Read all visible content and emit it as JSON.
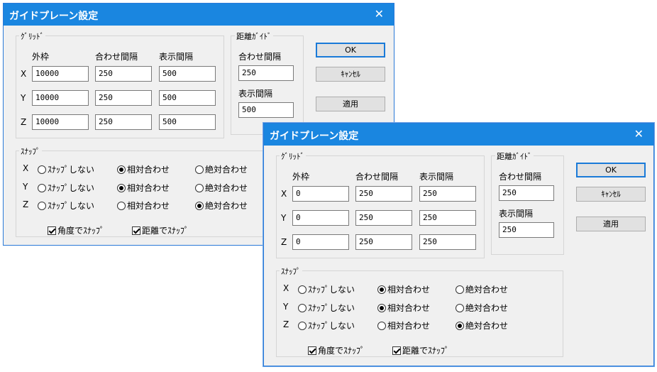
{
  "dialogs": [
    {
      "title": "ガイドプレーン設定",
      "grid_label": "ｸﾞﾘｯﾄﾞ",
      "col_outer": "外枠",
      "col_align": "合わせ間隔",
      "col_display": "表示間隔",
      "rows": [
        {
          "axis": "X",
          "outer": "10000",
          "align": "250",
          "display": "500"
        },
        {
          "axis": "Y",
          "outer": "10000",
          "align": "250",
          "display": "500"
        },
        {
          "axis": "Z",
          "outer": "10000",
          "align": "250",
          "display": "500"
        }
      ],
      "distance_label": "距離ｶﾞｲﾄﾞ",
      "dist_align_label": "合わせ間隔",
      "dist_align_value": "250",
      "dist_display_label": "表示間隔",
      "dist_display_value": "500",
      "ok": "OK",
      "cancel": "ｷｬﾝｾﾙ",
      "apply": "適用",
      "snap_label": "ｽﾅｯﾌﾟ",
      "snap_rows": [
        {
          "axis": "X",
          "selected": "relative"
        },
        {
          "axis": "Y",
          "selected": "relative"
        },
        {
          "axis": "Z",
          "selected": "absolute"
        }
      ],
      "opt_none": "ｽﾅｯﾌﾟしない",
      "opt_relative": "相対合わせ",
      "opt_absolute": "絶対合わせ",
      "angle_snap": "角度でｽﾅｯﾌﾟ",
      "angle_snap_checked": true,
      "distance_snap": "距離でｽﾅｯﾌﾟ",
      "distance_snap_checked": true
    },
    {
      "title": "ガイドプレーン設定",
      "grid_label": "ｸﾞﾘｯﾄﾞ",
      "col_outer": "外枠",
      "col_align": "合わせ間隔",
      "col_display": "表示間隔",
      "rows": [
        {
          "axis": "X",
          "outer": "0",
          "align": "250",
          "display": "250"
        },
        {
          "axis": "Y",
          "outer": "0",
          "align": "250",
          "display": "250"
        },
        {
          "axis": "Z",
          "outer": "0",
          "align": "250",
          "display": "250"
        }
      ],
      "distance_label": "距離ｶﾞｲﾄﾞ",
      "dist_align_label": "合わせ間隔",
      "dist_align_value": "250",
      "dist_display_label": "表示間隔",
      "dist_display_value": "250",
      "ok": "OK",
      "cancel": "ｷｬﾝｾﾙ",
      "apply": "適用",
      "snap_label": "ｽﾅｯﾌﾟ",
      "snap_rows": [
        {
          "axis": "X",
          "selected": "relative"
        },
        {
          "axis": "Y",
          "selected": "relative"
        },
        {
          "axis": "Z",
          "selected": "absolute"
        }
      ],
      "opt_none": "ｽﾅｯﾌﾟしない",
      "opt_relative": "相対合わせ",
      "opt_absolute": "絶対合わせ",
      "angle_snap": "角度でｽﾅｯﾌﾟ",
      "angle_snap_checked": true,
      "distance_snap": "距離でｽﾅｯﾌﾟ",
      "distance_snap_checked": true
    }
  ],
  "colors": {
    "titlebar": "#1a86e0",
    "dialog_bg": "#f0f0f0",
    "default_border": "#1a7ad8"
  },
  "icons": {
    "close": "close-icon"
  }
}
